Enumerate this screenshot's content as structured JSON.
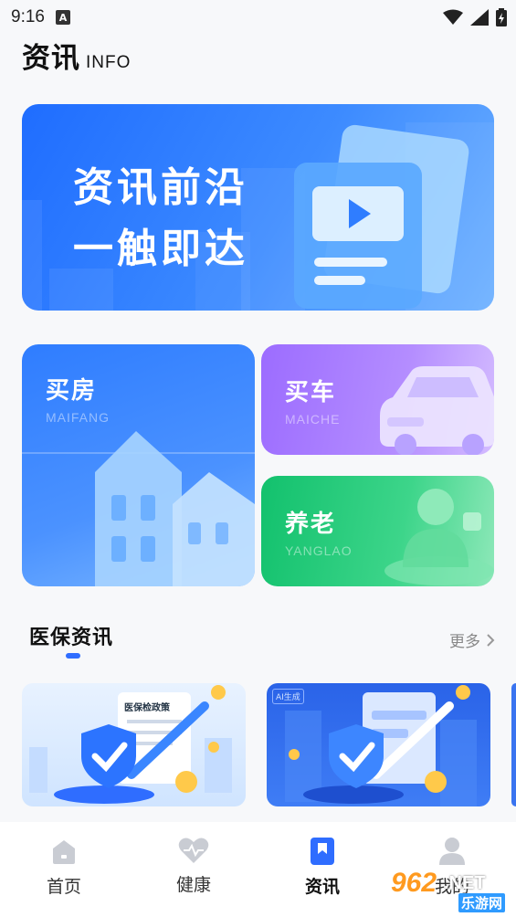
{
  "status": {
    "time": "9:16",
    "notif": "A"
  },
  "header": {
    "title": "资讯",
    "subtitle": "INFO"
  },
  "banner": {
    "line1": "资讯前沿",
    "line2": "一触即达"
  },
  "tiles": [
    {
      "title": "买房",
      "subtitle": "MAIFANG"
    },
    {
      "title": "买车",
      "subtitle": "MAICHE"
    },
    {
      "title": "养老",
      "subtitle": "YANGLAO"
    }
  ],
  "section": {
    "title": "医保资讯",
    "more": "更多"
  },
  "cards": [
    {
      "label": "医保检政策"
    },
    {
      "badge": "AI生成"
    }
  ],
  "tabbar": [
    {
      "label": "首页",
      "active": false
    },
    {
      "label": "健康",
      "active": false
    },
    {
      "label": "资讯",
      "active": true
    },
    {
      "label": "我的",
      "active": false
    }
  ],
  "watermark": {
    "brand": "962",
    "net": ".NET",
    "site": "乐游网"
  },
  "colors": {
    "accent": "#2f6dff",
    "banner": "#1f6dff",
    "car": "#9c6cff",
    "pension": "#12c16d"
  }
}
